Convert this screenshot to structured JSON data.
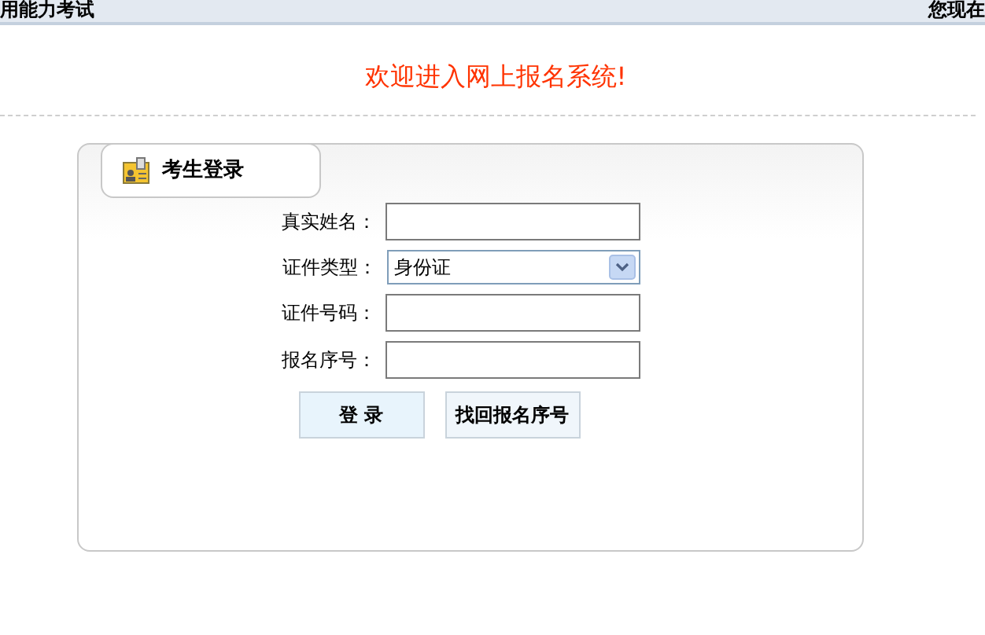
{
  "top_bar": {
    "title": "用能力考试",
    "right_text": "您现在"
  },
  "welcome": "欢迎进入网上报名系统!",
  "login_panel": {
    "tab_title": "考生登录",
    "fields": [
      {
        "kind": "text",
        "label": "真实姓名："
      },
      {
        "kind": "select",
        "label": "证件类型：",
        "value": "身份证"
      },
      {
        "kind": "text",
        "label": "证件号码："
      },
      {
        "kind": "text",
        "label": "报名序号："
      }
    ],
    "buttons": [
      "登 录",
      "找回报名序号"
    ]
  }
}
